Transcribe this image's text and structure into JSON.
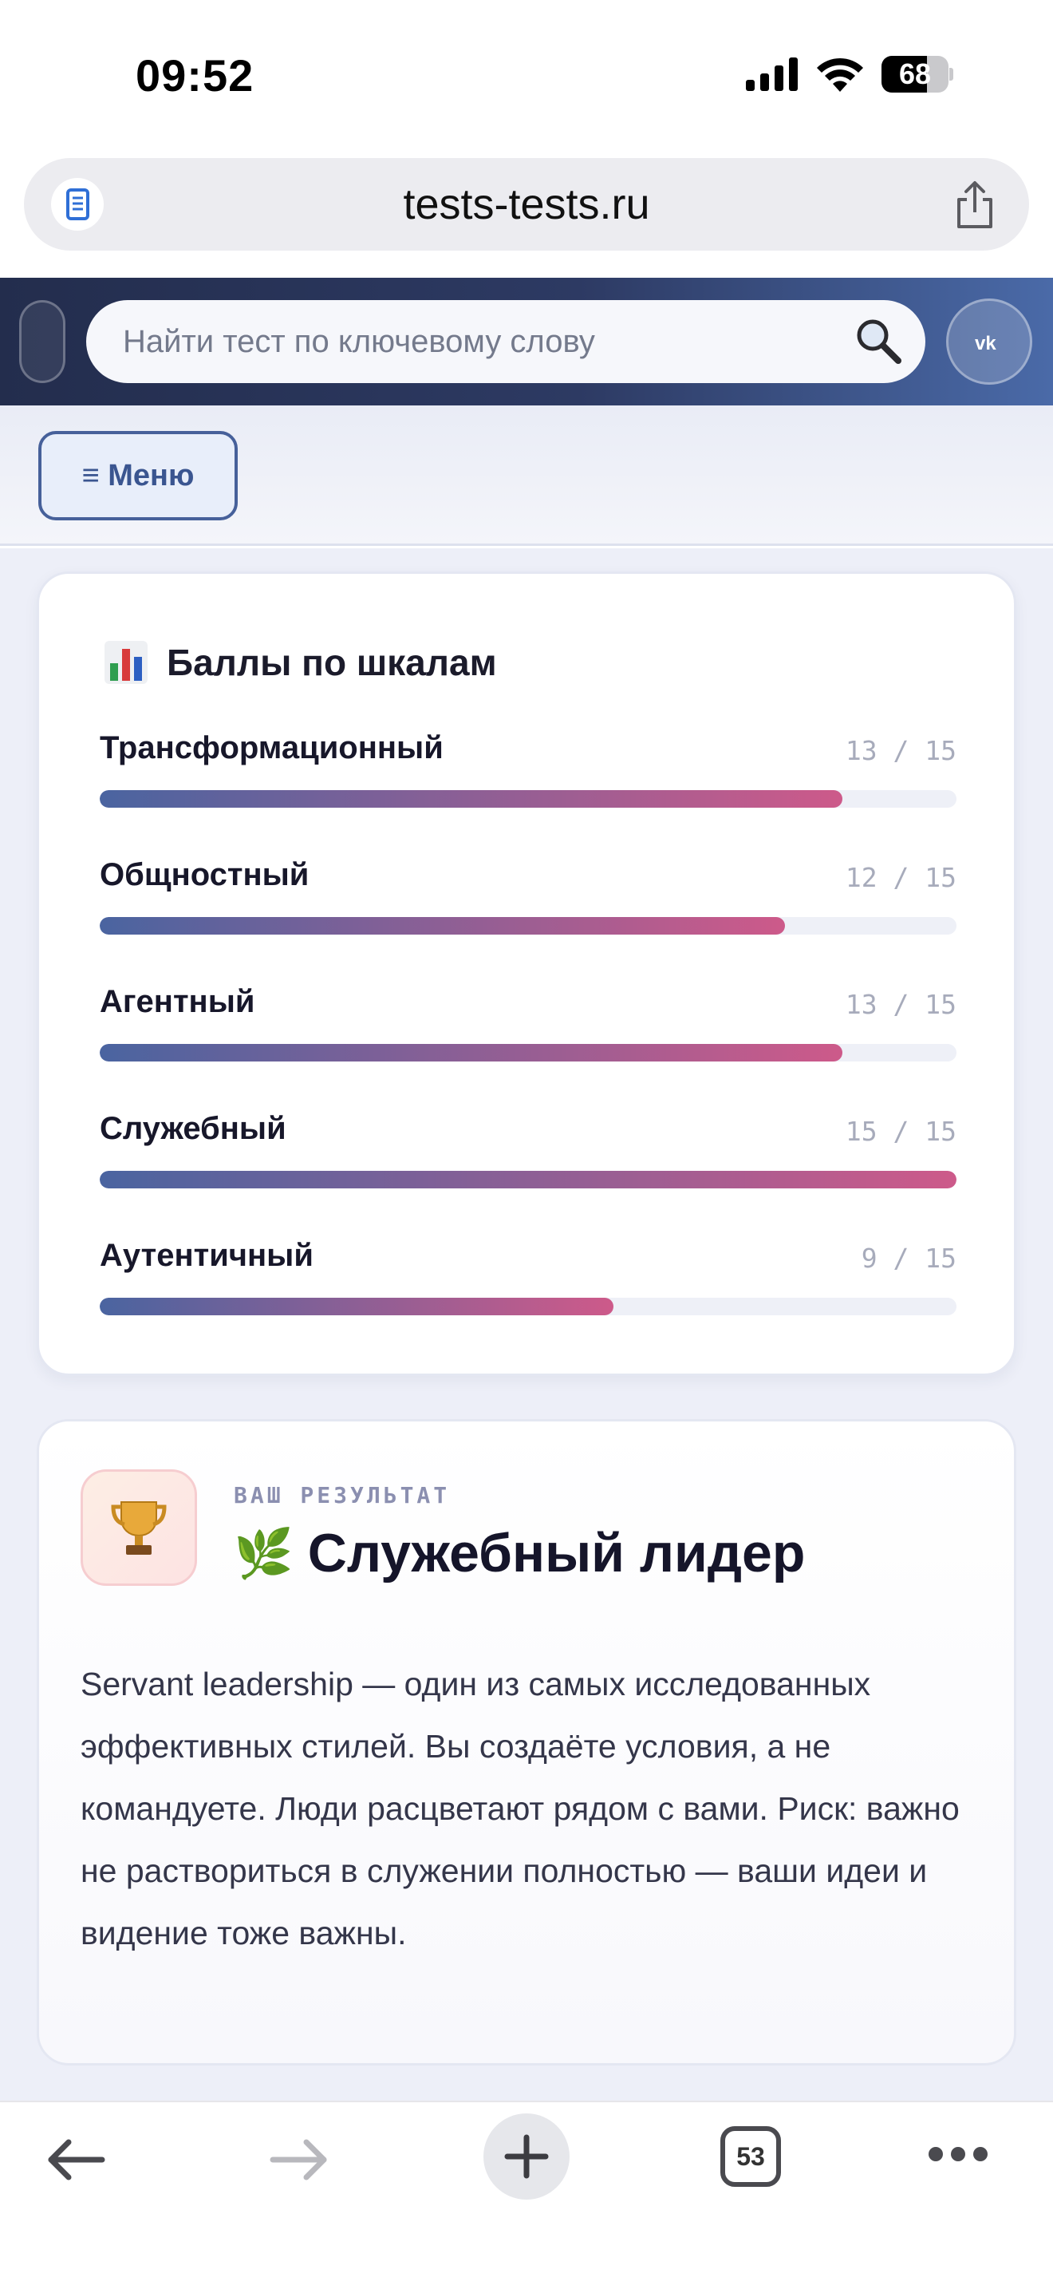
{
  "status_bar": {
    "time": "09:52",
    "battery_percent": 68,
    "battery_label": "68"
  },
  "browser": {
    "url": "tests-tests.ru",
    "open_tabs": "53"
  },
  "header": {
    "search_placeholder": "Найти тест по ключевому слову",
    "vk_label": "ВК"
  },
  "menu": {
    "label": "≡ Меню"
  },
  "scores": {
    "title": "Баллы по шкалам",
    "items": [
      {
        "name": "Трансформационный",
        "score_text": "13 / 15",
        "value": 13,
        "max": 15
      },
      {
        "name": "Общностный",
        "score_text": "12 / 15",
        "value": 12,
        "max": 15
      },
      {
        "name": "Агентный",
        "score_text": "13 / 15",
        "value": 13,
        "max": 15
      },
      {
        "name": "Служебный",
        "score_text": "15 / 15",
        "value": 15,
        "max": 15
      },
      {
        "name": "Аутентичный",
        "score_text": "9 / 15",
        "value": 9,
        "max": 15
      }
    ]
  },
  "result": {
    "kicker": "ВАШ РЕЗУЛЬТАТ",
    "emoji": "🌿",
    "title": "Служебный лидер",
    "description": "Servant leadership — один из самых исследованных эффективных стилей. Вы создаёте условия, а не командуете. Люди расцветают рядом с вами. Риск: важно не раствориться в служении полностью — ваши идеи и видение тоже важны."
  },
  "colors": {
    "accent": "#46609a",
    "bar_start": "#4a64a0",
    "bar_end": "#cd5a8a",
    "header_dark": "#232d4d"
  },
  "icons": {
    "chart": "bar-chart-icon",
    "trophy": "trophy-icon",
    "search": "magnifier-icon"
  }
}
